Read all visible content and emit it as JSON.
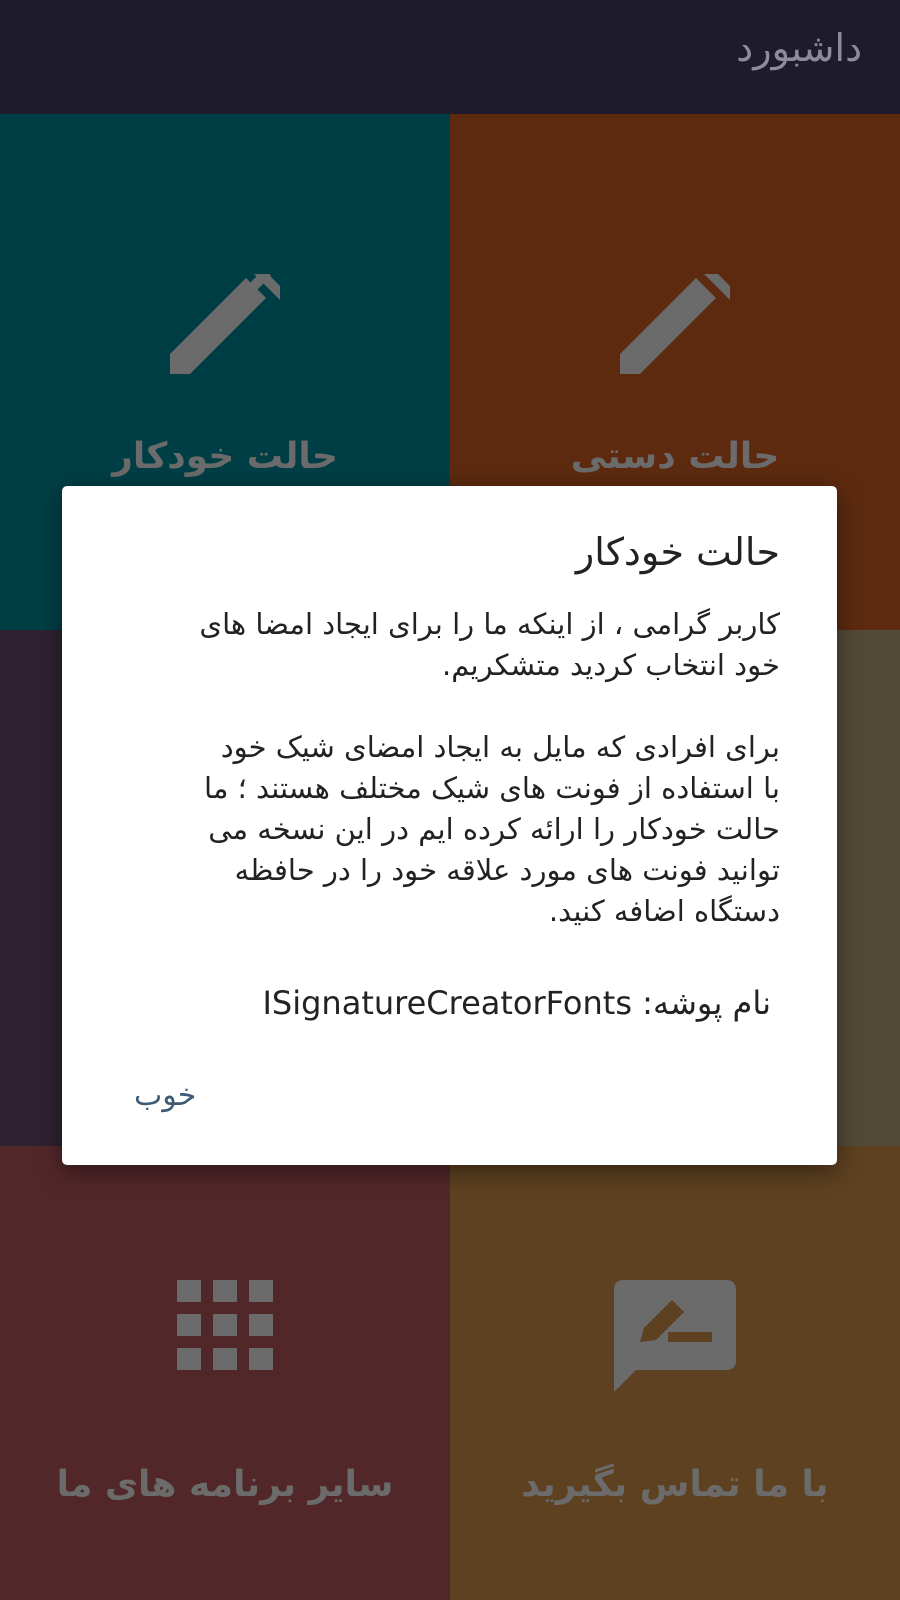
{
  "app_bar": {
    "title": "داشبورد"
  },
  "tiles": [
    {
      "label": "حالت خودکار",
      "icon": "pencil-icon",
      "color": "#003e46"
    },
    {
      "label": "حالت دستی",
      "icon": "pencil-icon",
      "color": "#5d2a0f"
    },
    {
      "label": "",
      "icon": "",
      "color": "#2e2131"
    },
    {
      "label": "",
      "icon": "",
      "color": "#524a37"
    },
    {
      "label": "سایر برنامه های ما",
      "icon": "grid-apps-icon",
      "color": "#52272a"
    },
    {
      "label": "با ما تماس بگیرید",
      "icon": "feedback-chat-icon",
      "color": "#5e4120"
    }
  ],
  "dialog": {
    "title": "حالت خودکار",
    "paragraph_1": "کاربر گرامی ، از اینکه ما را برای ایجاد امضا های\nخود انتخاب کردید متشکریم.",
    "paragraph_2": " برای افرادی که مایل به ایجاد امضای شیک خود\nبا استفاده از فونت های شیک مختلف هستند ؛ ما\nحالت خودکار را ارائه کرده ایم  در این نسخه می\nتوانید فونت های مورد علاقه خود را در حافظه\nدستگاه اضافه کنید.",
    "folder_label": "نام پوشه: ",
    "folder_name": "ISignatureCreatorFonts",
    "ok_label": "خوب"
  },
  "colors": {
    "app_bar": "#1e1b2c",
    "icon_gray": "#6b6b6b",
    "dialog_button": "#3e5a75"
  }
}
